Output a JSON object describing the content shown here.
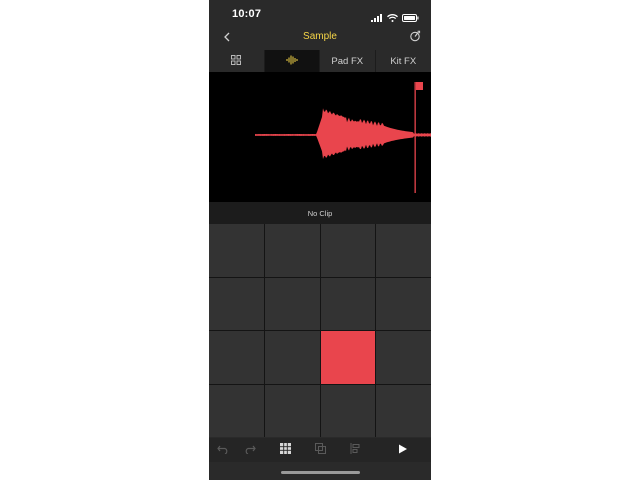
{
  "status_bar": {
    "time": "10:07"
  },
  "header": {
    "title": "Sample"
  },
  "tabs": [
    {
      "icon": "grid-icon",
      "label": ""
    },
    {
      "icon": "waveform-icon",
      "label": ""
    },
    {
      "label": "Pad FX"
    },
    {
      "label": "Kit FX"
    }
  ],
  "active_tab_index": 1,
  "clip": {
    "label": "No Clip"
  },
  "pads": {
    "rows": 4,
    "cols": 4,
    "active_index": 10
  },
  "colors": {
    "accent": "#f5d547",
    "waveform": "#e9454d",
    "active_pad": "#e9454d",
    "background": "#2a2a2a"
  },
  "toolbar": {
    "icons": [
      "undo-icon",
      "redo-icon",
      "grid-view-icon",
      "copy-icon",
      "align-icon",
      "play-icon"
    ]
  }
}
